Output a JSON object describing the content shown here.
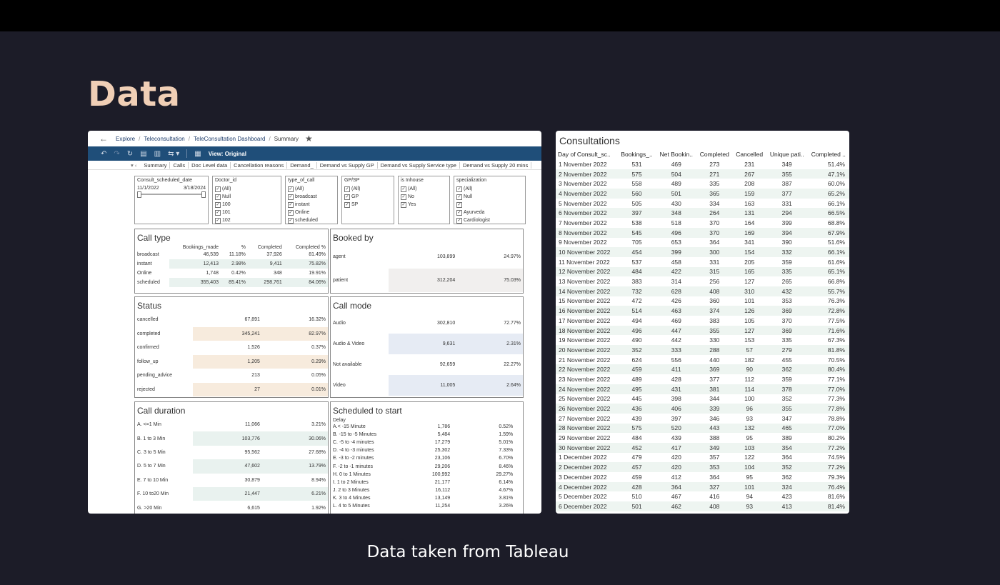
{
  "slide": {
    "title": "Data",
    "caption": "Data taken from Tableau"
  },
  "breadcrumb": {
    "items": [
      "Explore",
      "Teleconsultation",
      "TeleConsultation Dashboard",
      "Summary"
    ]
  },
  "toolbar": {
    "view_label": "View: Original"
  },
  "tabs": [
    "Summary",
    "Calls",
    "Doc Level data",
    "Cancellation reasons",
    "Demand_",
    "Demand vs Supply GP",
    "Demand vs Supply Service type",
    "Demand vs Supply 20 mins"
  ],
  "filters": {
    "date": {
      "title": "Consult_scheduled_date",
      "start": "11/1/2022",
      "end": "3/18/2024"
    },
    "doctor": {
      "title": "Doctor_id",
      "options": [
        "(All)",
        "Null",
        "100",
        "101",
        "102"
      ]
    },
    "type": {
      "title": "type_of_call",
      "options": [
        "(All)",
        "broadcast",
        "instant",
        "Online",
        "scheduled"
      ]
    },
    "gpsp": {
      "title": "GP/SP",
      "options": [
        "(All)",
        "GP",
        "SP"
      ]
    },
    "inhouse": {
      "title": "is Inhouse",
      "options": [
        "(All)",
        "No",
        "Yes"
      ]
    },
    "spec": {
      "title": "specialization",
      "options": [
        "(All)",
        "Null",
        "",
        "Ayurveda",
        "Cardiologist"
      ]
    }
  },
  "call_type": {
    "title": "Call type",
    "headers": [
      "",
      "Bookings_made",
      "%",
      "Completed",
      "Completed %"
    ],
    "rows": [
      [
        "broadcast",
        "46,539",
        "11.18%",
        "37,926",
        "81.49%"
      ],
      [
        "instant",
        "12,413",
        "2.98%",
        "9,411",
        "75.82%"
      ],
      [
        "Online",
        "1,748",
        "0.42%",
        "348",
        "19.91%"
      ],
      [
        "scheduled",
        "355,403",
        "85.41%",
        "298,761",
        "84.06%"
      ]
    ]
  },
  "booked_by": {
    "title": "Booked by",
    "rows": [
      [
        "agent",
        "103,899",
        "24.97%"
      ],
      [
        "patient",
        "312,204",
        "75.03%"
      ]
    ]
  },
  "status": {
    "title": "Status",
    "rows": [
      [
        "cancelled",
        "67,891",
        "16.32%"
      ],
      [
        "completed",
        "345,241",
        "82.97%"
      ],
      [
        "confirmed",
        "1,526",
        "0.37%"
      ],
      [
        "follow_up",
        "1,205",
        "0.29%"
      ],
      [
        "pending_advice",
        "213",
        "0.05%"
      ],
      [
        "rejected",
        "27",
        "0.01%"
      ]
    ]
  },
  "call_mode": {
    "title": "Call mode",
    "rows": [
      [
        "Audio",
        "302,810",
        "72.77%"
      ],
      [
        "Audio & Video",
        "9,631",
        "2.31%"
      ],
      [
        "Not available",
        "92,659",
        "22.27%"
      ],
      [
        "Video",
        "11,005",
        "2.64%"
      ]
    ]
  },
  "call_duration": {
    "title": "Call duration",
    "rows": [
      [
        "A. <=1 Min",
        "11,066",
        "3.21%"
      ],
      [
        "B. 1 to 3 Min",
        "103,776",
        "30.06%"
      ],
      [
        "C. 3 to 5 Min",
        "95,562",
        "27.68%"
      ],
      [
        "D. 5 to 7 Min",
        "47,602",
        "13.79%"
      ],
      [
        "E. 7 to 10 Min",
        "30,879",
        "8.94%"
      ],
      [
        "F. 10 to20 Min",
        "21,447",
        "6.21%"
      ],
      [
        "G. >20 Min",
        "6,615",
        "1.92%"
      ]
    ]
  },
  "scheduled": {
    "title": "Scheduled to start",
    "header": "Delay",
    "rows": [
      [
        "A.< -15 Minute",
        "1,786",
        "0.52%"
      ],
      [
        "B. -15 to -5 Minutes",
        "5,484",
        "1.59%"
      ],
      [
        "C. -5 to -4 minutes",
        "17,279",
        "5.01%"
      ],
      [
        "D. -4 to -3 minutes",
        "25,302",
        "7.33%"
      ],
      [
        "E. -3 to -2 minutes",
        "23,106",
        "6.70%"
      ],
      [
        "F. -2 to -1 minutes",
        "29,206",
        "8.46%"
      ],
      [
        "H. 0 to 1 Minutes",
        "100,992",
        "29.27%"
      ],
      [
        "I. 1 to 2 Minutes",
        "21,177",
        "6.14%"
      ],
      [
        "J. 2 to 3 Minutes",
        "16,112",
        "4.67%"
      ],
      [
        "K. 3 to 4 Minutes",
        "13,149",
        "3.81%"
      ],
      [
        "L. 4 to 5 Minutes",
        "11,254",
        "3.26%"
      ]
    ]
  },
  "consultations": {
    "title": "Consultations",
    "headers": [
      "Day of Consult_sc..",
      "Bookings_..",
      "Net Bookin..",
      "Completed",
      "Cancelled",
      "Unique pati..",
      "Completed .."
    ],
    "rows": [
      [
        "1 November 2022",
        "531",
        "469",
        "273",
        "231",
        "349",
        "51.4%"
      ],
      [
        "2 November 2022",
        "575",
        "504",
        "271",
        "267",
        "355",
        "47.1%"
      ],
      [
        "3 November 2022",
        "558",
        "489",
        "335",
        "208",
        "387",
        "60.0%"
      ],
      [
        "4 November 2022",
        "560",
        "501",
        "365",
        "159",
        "377",
        "65.2%"
      ],
      [
        "5 November 2022",
        "505",
        "430",
        "334",
        "163",
        "331",
        "66.1%"
      ],
      [
        "6 November 2022",
        "397",
        "348",
        "264",
        "131",
        "294",
        "66.5%"
      ],
      [
        "7 November 2022",
        "538",
        "518",
        "370",
        "164",
        "399",
        "68.8%"
      ],
      [
        "8 November 2022",
        "545",
        "496",
        "370",
        "169",
        "394",
        "67.9%"
      ],
      [
        "9 November 2022",
        "705",
        "653",
        "364",
        "341",
        "390",
        "51.6%"
      ],
      [
        "10 November 2022",
        "454",
        "399",
        "300",
        "154",
        "332",
        "66.1%"
      ],
      [
        "11 November 2022",
        "537",
        "458",
        "331",
        "205",
        "359",
        "61.6%"
      ],
      [
        "12 November 2022",
        "484",
        "422",
        "315",
        "165",
        "335",
        "65.1%"
      ],
      [
        "13 November 2022",
        "383",
        "314",
        "256",
        "127",
        "265",
        "66.8%"
      ],
      [
        "14 November 2022",
        "732",
        "628",
        "408",
        "310",
        "432",
        "55.7%"
      ],
      [
        "15 November 2022",
        "472",
        "426",
        "360",
        "101",
        "353",
        "76.3%"
      ],
      [
        "16 November 2022",
        "514",
        "463",
        "374",
        "126",
        "369",
        "72.8%"
      ],
      [
        "17 November 2022",
        "494",
        "469",
        "383",
        "105",
        "370",
        "77.5%"
      ],
      [
        "18 November 2022",
        "496",
        "447",
        "355",
        "127",
        "369",
        "71.6%"
      ],
      [
        "19 November 2022",
        "490",
        "442",
        "330",
        "153",
        "335",
        "67.3%"
      ],
      [
        "20 November 2022",
        "352",
        "333",
        "288",
        "57",
        "279",
        "81.8%"
      ],
      [
        "21 November 2022",
        "624",
        "556",
        "440",
        "182",
        "455",
        "70.5%"
      ],
      [
        "22 November 2022",
        "459",
        "411",
        "369",
        "90",
        "362",
        "80.4%"
      ],
      [
        "23 November 2022",
        "489",
        "428",
        "377",
        "112",
        "359",
        "77.1%"
      ],
      [
        "24 November 2022",
        "495",
        "431",
        "381",
        "114",
        "378",
        "77.0%"
      ],
      [
        "25 November 2022",
        "445",
        "398",
        "344",
        "100",
        "352",
        "77.3%"
      ],
      [
        "26 November 2022",
        "436",
        "406",
        "339",
        "96",
        "355",
        "77.8%"
      ],
      [
        "27 November 2022",
        "439",
        "397",
        "346",
        "93",
        "347",
        "78.8%"
      ],
      [
        "28 November 2022",
        "575",
        "520",
        "443",
        "132",
        "465",
        "77.0%"
      ],
      [
        "29 November 2022",
        "484",
        "439",
        "388",
        "95",
        "389",
        "80.2%"
      ],
      [
        "30 November 2022",
        "452",
        "417",
        "349",
        "103",
        "354",
        "77.2%"
      ],
      [
        "1 December 2022",
        "479",
        "420",
        "357",
        "122",
        "364",
        "74.5%"
      ],
      [
        "2 December 2022",
        "457",
        "420",
        "353",
        "104",
        "352",
        "77.2%"
      ],
      [
        "3 December 2022",
        "459",
        "412",
        "364",
        "95",
        "362",
        "79.3%"
      ],
      [
        "4 December 2022",
        "428",
        "364",
        "327",
        "101",
        "324",
        "76.4%"
      ],
      [
        "5 December 2022",
        "510",
        "467",
        "416",
        "94",
        "423",
        "81.6%"
      ],
      [
        "6 December 2022",
        "501",
        "462",
        "408",
        "93",
        "413",
        "81.4%"
      ]
    ]
  }
}
